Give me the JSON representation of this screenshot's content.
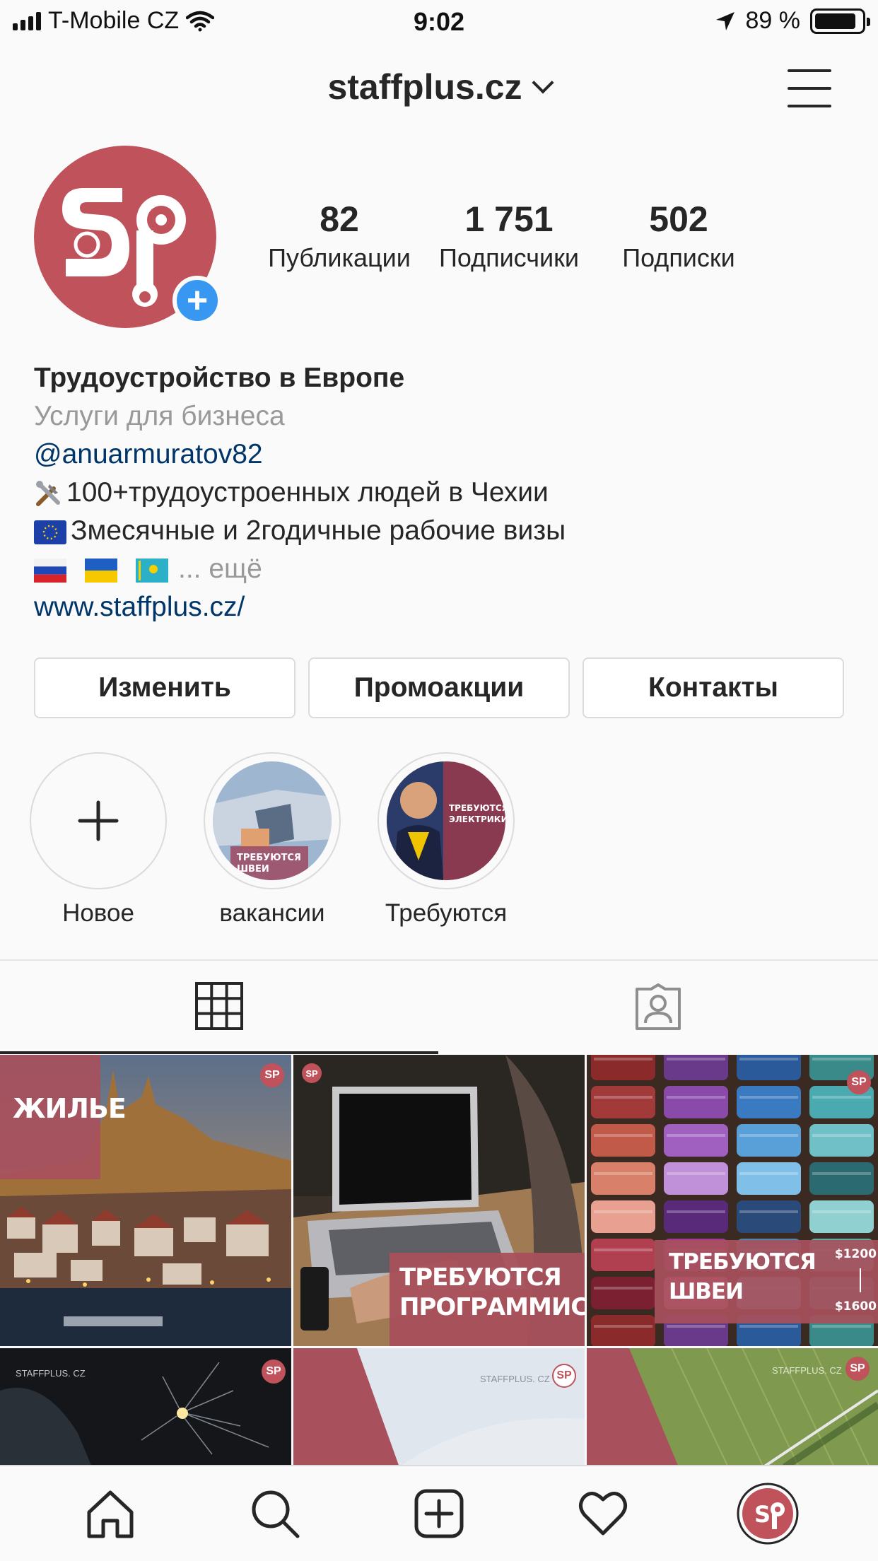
{
  "status_bar": {
    "carrier": "T-Mobile CZ",
    "time": "9:02",
    "battery": "89 %",
    "battery_level": 0.89
  },
  "header": {
    "username": "staffplus.cz"
  },
  "profile": {
    "stats": [
      {
        "count": "82",
        "label": "Публикации"
      },
      {
        "count": "1 751",
        "label": "Подписчики"
      },
      {
        "count": "502",
        "label": "Подписки"
      }
    ],
    "bio": {
      "name": "Трудоустройство в Европе",
      "category": "Услуги для бизнеса",
      "mention": "@anuarmuratov82",
      "line1": "100+трудоустроенных людей в Чехии",
      "line2": "Змесячные и 2годичные рабочие визы",
      "more": "... ещё",
      "website": "www.staffplus.cz/"
    },
    "buttons": {
      "edit": "Изменить",
      "promotions": "Промоакции",
      "contacts": "Контакты"
    }
  },
  "highlights": [
    {
      "label": "Новое"
    },
    {
      "label": "вакансии",
      "caption": "ТРЕБУЮТСЯ ШВЕИ"
    },
    {
      "label": "Требуются",
      "caption": "ТРЕБУЮТСЯ ЭЛЕКТРИКИ"
    }
  ],
  "posts": [
    {
      "text": "ЖИЛЬЕ"
    },
    {
      "text_line1": "ТРЕБУЮТСЯ",
      "text_line2": "ПРОГРАММИСТЫ!"
    },
    {
      "text_line1": "ТРЕБУЮТСЯ",
      "text_line2": "ШВЕИ",
      "price_top": "$1200",
      "price_bottom": "$1600"
    },
    {
      "watermark": "STAFFPLUS. CZ"
    },
    {
      "watermark": "STAFFPLUS. CZ"
    },
    {
      "watermark": "STAFFPLUS. CZ"
    }
  ],
  "colors": {
    "brand": "#c0525b",
    "accent_blue": "#3897f0",
    "link": "#003569"
  }
}
